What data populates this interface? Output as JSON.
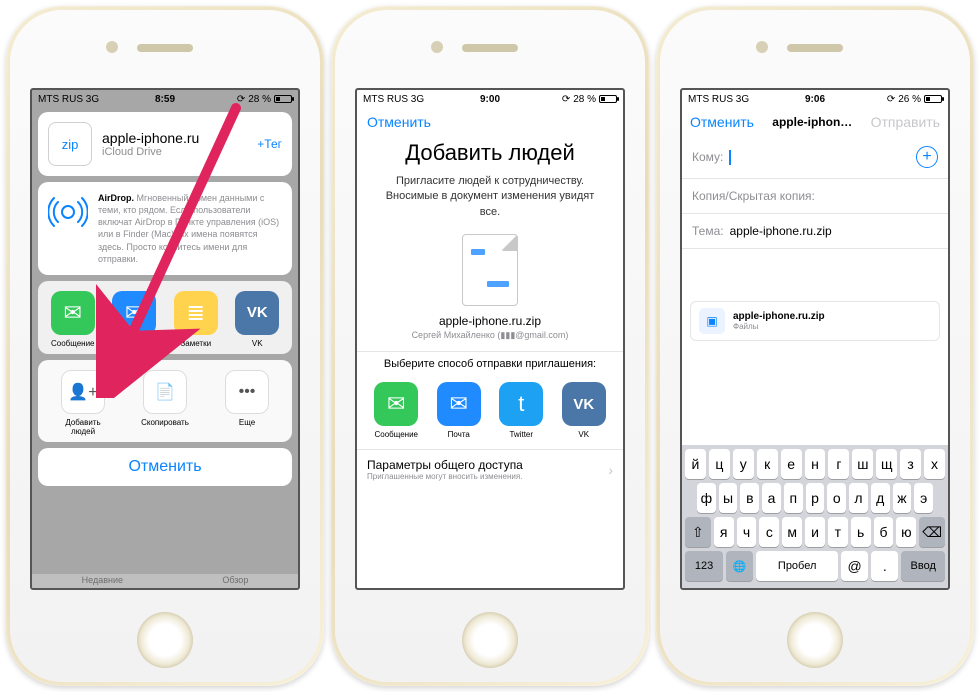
{
  "phone1": {
    "status": {
      "carrier": "MTS RUS  3G",
      "time": "8:59",
      "battery": "28 %"
    },
    "file": {
      "badge": "zip",
      "name": "apple-iphone.ru",
      "location": "iCloud Drive",
      "tag": "+Тег"
    },
    "airdrop": {
      "title": "AirDrop.",
      "body": "Мгновенный обмен данными с теми, кто рядом. Если пользователи включат AirDrop в Пункте управления (iOS) или в Finder (Mac), их имена появятся здесь. Просто коснитесь имени для отправки."
    },
    "share_apps": [
      {
        "name": "Сообщение",
        "color": "#34c759",
        "glyph": "✉"
      },
      {
        "name": "Почта",
        "color": "#1f8bff",
        "glyph": "✉"
      },
      {
        "name": "Заметки",
        "color": "#ffd34d",
        "glyph": "≣"
      },
      {
        "name": "VK",
        "color": "#4a76a8",
        "glyph": "VK"
      }
    ],
    "actions": [
      {
        "name": "Добавить людей",
        "glyph": "👤+"
      },
      {
        "name": "Скопировать",
        "glyph": "📄"
      },
      {
        "name": "Еще",
        "glyph": "•••"
      }
    ],
    "cancel": "Отменить",
    "bottom_tabs": {
      "left": "Недавние",
      "right": "Обзор"
    }
  },
  "phone2": {
    "status": {
      "carrier": "MTS RUS  3G",
      "time": "9:00",
      "battery": "28 %"
    },
    "cancel": "Отменить",
    "title": "Добавить людей",
    "subtitle": "Пригласите людей к сотрудничеству. Вносимые в документ изменения увидят все.",
    "filename": "apple-iphone.ru.zip",
    "owner": "Сергей Михайленко (▮▮▮@gmail.com)",
    "choose_label": "Выберите способ отправки приглашения:",
    "apps": [
      {
        "name": "Сообщение",
        "color": "#34c759",
        "glyph": "✉"
      },
      {
        "name": "Почта",
        "color": "#1f8bff",
        "glyph": "✉"
      },
      {
        "name": "Twitter",
        "color": "#1da1f2",
        "glyph": "t"
      },
      {
        "name": "VK",
        "color": "#4a76a8",
        "glyph": "VK"
      }
    ],
    "access": {
      "title": "Параметры общего доступа",
      "sub": "Приглашенные могут вносить изменения."
    }
  },
  "phone3": {
    "status": {
      "carrier": "MTS RUS  3G",
      "time": "9:06",
      "battery": "26 %"
    },
    "header": {
      "cancel": "Отменить",
      "title": "apple-iphon…",
      "send": "Отправить"
    },
    "fields": {
      "to": "Кому:",
      "cc": "Копия/Скрытая копия:",
      "subject_label": "Тема:",
      "subject_value": "apple-iphone.ru.zip"
    },
    "attachment": {
      "name": "apple-iphone.ru.zip",
      "sub": "Файлы"
    },
    "keyboard": {
      "r1": [
        "й",
        "ц",
        "у",
        "к",
        "е",
        "н",
        "г",
        "ш",
        "щ",
        "з",
        "х"
      ],
      "r2": [
        "ф",
        "ы",
        "в",
        "а",
        "п",
        "р",
        "о",
        "л",
        "д",
        "ж",
        "э"
      ],
      "r3": [
        "я",
        "ч",
        "с",
        "м",
        "и",
        "т",
        "ь",
        "б",
        "ю"
      ],
      "r4": {
        "num": "123",
        "space": "Пробел",
        "at": "@",
        "dot": ".",
        "ret": "Ввод"
      }
    }
  }
}
